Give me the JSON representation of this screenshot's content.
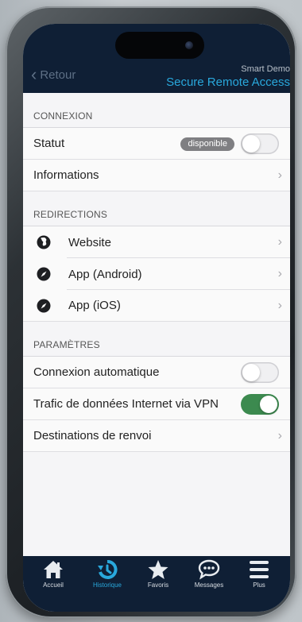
{
  "header": {
    "back_label": "Retour",
    "app_name": "Smart Demo",
    "screen_title": "Secure Remote Access"
  },
  "sections": [
    {
      "title": "CONNEXION",
      "rows": [
        {
          "label": "Statut",
          "badge": "disponible",
          "toggle": false
        },
        {
          "label": "Informations"
        }
      ]
    },
    {
      "title": "REDIRECTIONS",
      "rows": [
        {
          "label": "Website",
          "icon": "globe-icon"
        },
        {
          "label": "App (Android)",
          "icon": "compass-icon"
        },
        {
          "label": "App (iOS)",
          "icon": "compass-icon"
        }
      ]
    },
    {
      "title": "PARAMÈTRES",
      "rows": [
        {
          "label": "Connexion automatique",
          "toggle": false
        },
        {
          "label": "Trafic de données Internet via VPN",
          "toggle": true
        },
        {
          "label": "Destinations de renvoi"
        }
      ]
    }
  ],
  "tabbar": {
    "items": [
      {
        "label": "Accueil",
        "icon": "home-icon",
        "active": false
      },
      {
        "label": "Historique",
        "icon": "history-icon",
        "active": true
      },
      {
        "label": "Favoris",
        "icon": "star-icon",
        "active": false
      },
      {
        "label": "Messages",
        "icon": "chat-icon",
        "active": false
      },
      {
        "label": "Plus",
        "icon": "menu-icon",
        "active": false
      }
    ]
  },
  "colors": {
    "header_bg": "#0f1f35",
    "accent": "#29a8dc",
    "toggle_on": "#3c8a4f"
  }
}
